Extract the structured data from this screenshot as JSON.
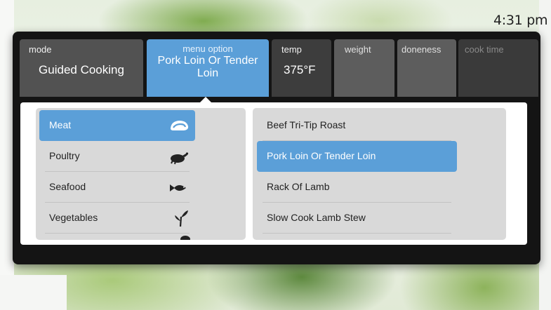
{
  "status": {
    "time": "4:31 pm"
  },
  "tabs": {
    "mode": {
      "label": "mode",
      "value": "Guided Cooking"
    },
    "menu_option": {
      "label": "menu option",
      "value": "Pork Loin Or Tender Loin"
    },
    "temp": {
      "label": "temp",
      "value": "375°F"
    },
    "weight": {
      "label": "weight"
    },
    "doneness": {
      "label": "doneness"
    },
    "cook_time": {
      "label": "cook time"
    }
  },
  "categories": [
    {
      "label": "Meat",
      "icon": "meat-icon",
      "selected": true
    },
    {
      "label": "Poultry",
      "icon": "poultry-icon",
      "selected": false
    },
    {
      "label": "Seafood",
      "icon": "fish-icon",
      "selected": false
    },
    {
      "label": "Vegetables",
      "icon": "vegetable-icon",
      "selected": false
    }
  ],
  "recipes": [
    {
      "label": "Beef Tri-Tip Roast",
      "selected": false
    },
    {
      "label": "Pork Loin Or Tender Loin",
      "selected": true
    },
    {
      "label": "Rack Of Lamb",
      "selected": false
    },
    {
      "label": "Slow Cook Lamb Stew",
      "selected": false
    }
  ],
  "colors": {
    "accent": "#5b9fd8",
    "panel": "#141414",
    "list_bg": "#d9d9d9"
  }
}
